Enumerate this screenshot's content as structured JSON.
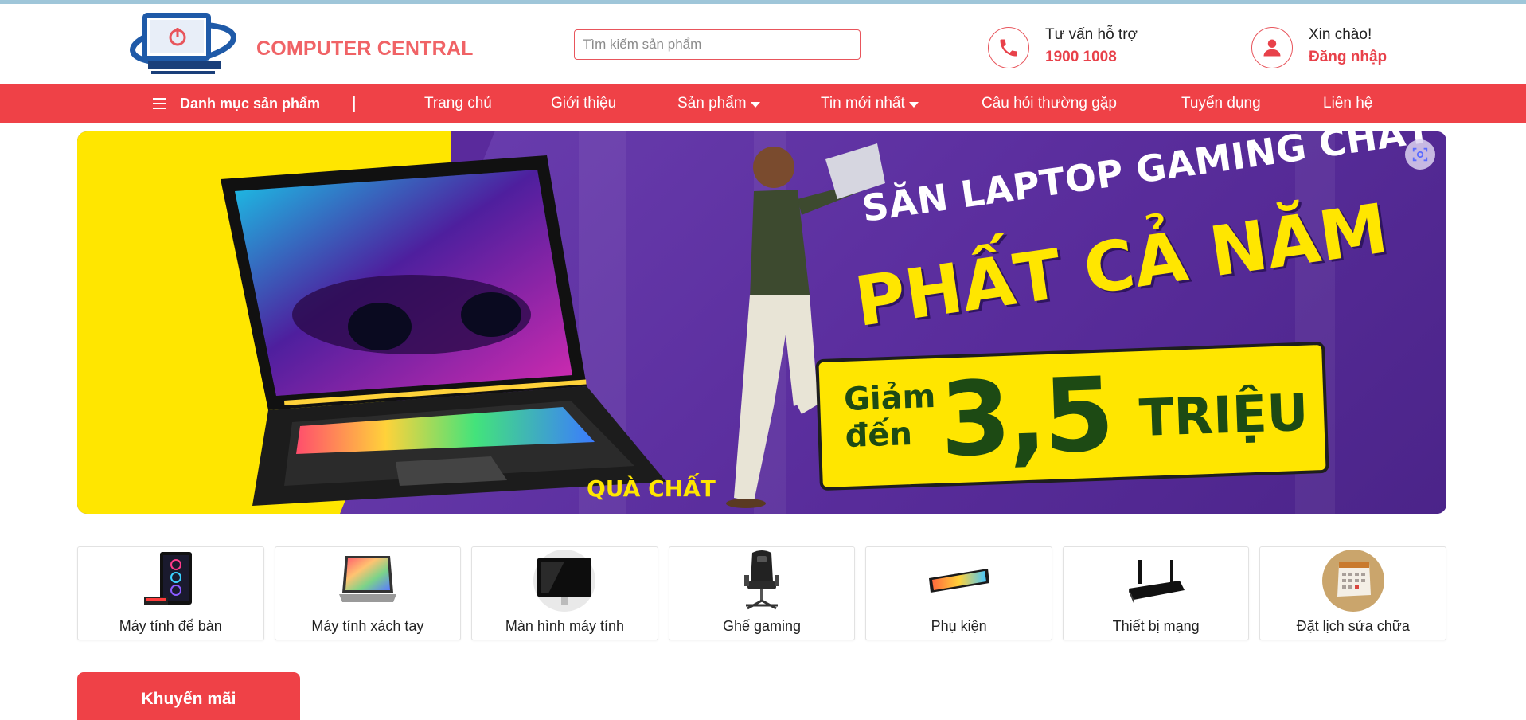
{
  "header": {
    "brand": "COMPUTER CENTRAL",
    "search": {
      "placeholder": "Tìm kiếm sản phẩm",
      "value": ""
    },
    "support": {
      "label": "Tư vấn hỗ trợ",
      "phone": "1900 1008"
    },
    "account": {
      "greeting": "Xin chào!",
      "login": "Đăng nhập"
    }
  },
  "nav": {
    "category_menu": "Danh mục sản phẩm",
    "separator": "|",
    "items": [
      {
        "label": "Trang chủ"
      },
      {
        "label": "Giới thiệu"
      },
      {
        "label": "Sản phẩm"
      },
      {
        "label": "Tin mới nhất"
      },
      {
        "label": "Câu hỏi thường gặp"
      },
      {
        "label": "Tuyển dụng"
      },
      {
        "label": "Liên hệ"
      }
    ]
  },
  "banner": {
    "headline_top": "SĂN LAPTOP GAMING CHẤT",
    "headline_main": "PHẤT CẢ NĂM",
    "discount_prefix": "Giảm đến",
    "discount_amount": "3,5",
    "discount_unit": "TRIỆU",
    "gift_text": "QUÀ CHẤT"
  },
  "categories": [
    {
      "label": "Máy tính để bàn",
      "icon": "desktop-pc-icon"
    },
    {
      "label": "Máy tính xách tay",
      "icon": "laptop-icon"
    },
    {
      "label": "Màn hình máy tính",
      "icon": "monitor-icon"
    },
    {
      "label": "Ghế gaming",
      "icon": "gaming-chair-icon"
    },
    {
      "label": "Phụ kiện",
      "icon": "keyboard-icon"
    },
    {
      "label": "Thiết bị mạng",
      "icon": "router-icon"
    },
    {
      "label": "Đặt lịch sửa chữa",
      "icon": "calendar-icon"
    }
  ],
  "promotions_tab": "Khuyến mãi",
  "colors": {
    "primary_red": "#ef4147",
    "brand_text": "#f06366",
    "banner_yellow": "#ffe600",
    "banner_purple": "#5b2e9e"
  }
}
